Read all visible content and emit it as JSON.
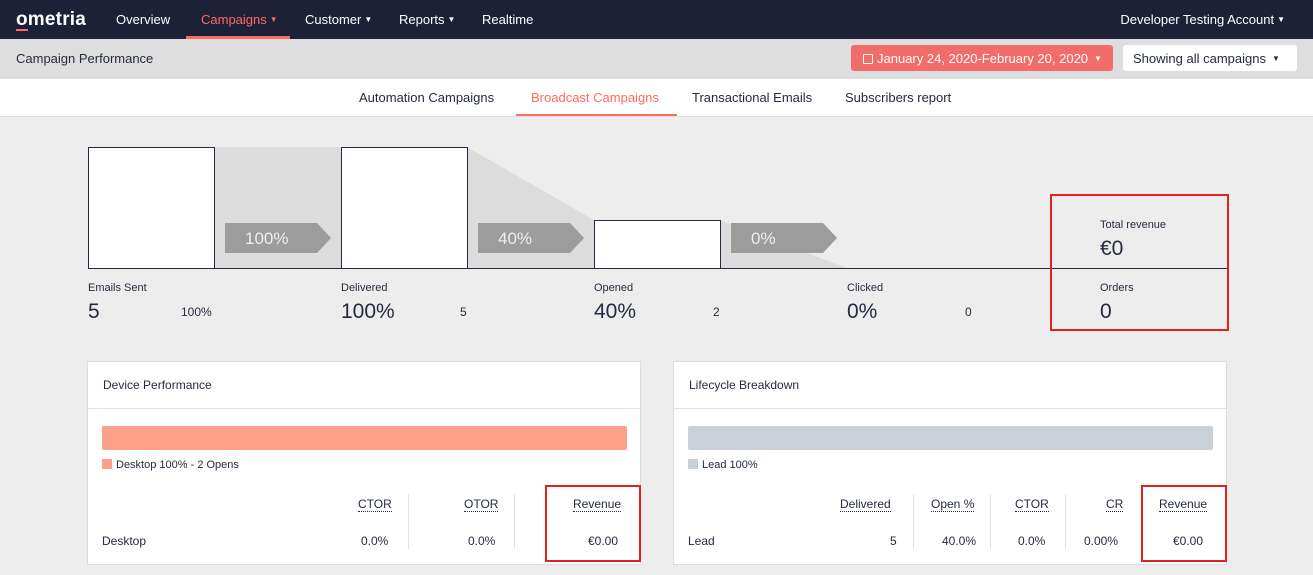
{
  "nav": {
    "logo": "ometria",
    "items": [
      {
        "label": "Overview"
      },
      {
        "label": "Campaigns"
      },
      {
        "label": "Customer"
      },
      {
        "label": "Reports"
      },
      {
        "label": "Realtime"
      }
    ],
    "account": "Developer Testing Account",
    "accent_color": "#ff6b5f"
  },
  "subheader": {
    "title": "Campaign Performance",
    "date_range": "January 24, 2020-February 20, 2020",
    "filter": "Showing all campaigns"
  },
  "tabs": [
    {
      "label": "Automation Campaigns"
    },
    {
      "label": "Broadcast Campaigns"
    },
    {
      "label": "Transactional Emails"
    },
    {
      "label": "Subscribers report"
    }
  ],
  "funnel": {
    "arrows": [
      "100%",
      "40%",
      "0%"
    ],
    "stats": [
      {
        "label": "Emails Sent",
        "value": "5",
        "sub": "100%"
      },
      {
        "label": "Delivered",
        "value": "100%",
        "sub": "5"
      },
      {
        "label": "Opened",
        "value": "40%",
        "sub": "2"
      },
      {
        "label": "Clicked",
        "value": "0%",
        "sub": "0"
      }
    ],
    "total_revenue_label": "Total revenue",
    "total_revenue": "€0",
    "orders_label": "Orders",
    "orders": "0"
  },
  "device": {
    "title": "Device Performance",
    "bar_color": "#fda08a",
    "legend": "Desktop 100% - 2 Opens",
    "headers": [
      "CTOR",
      "OTOR",
      "Revenue"
    ],
    "row": {
      "name": "Desktop",
      "ctor": "0.0%",
      "otor": "0.0%",
      "revenue": "€0.00"
    }
  },
  "lifecycle": {
    "title": "Lifecycle Breakdown",
    "bar_color": "#c9d0d8",
    "legend": "Lead 100%",
    "headers": [
      "Delivered",
      "Open %",
      "CTOR",
      "CR",
      "Revenue"
    ],
    "row": {
      "name": "Lead",
      "delivered": "5",
      "open": "40.0%",
      "ctor": "0.0%",
      "cr": "0.00%",
      "revenue": "€0.00"
    }
  }
}
